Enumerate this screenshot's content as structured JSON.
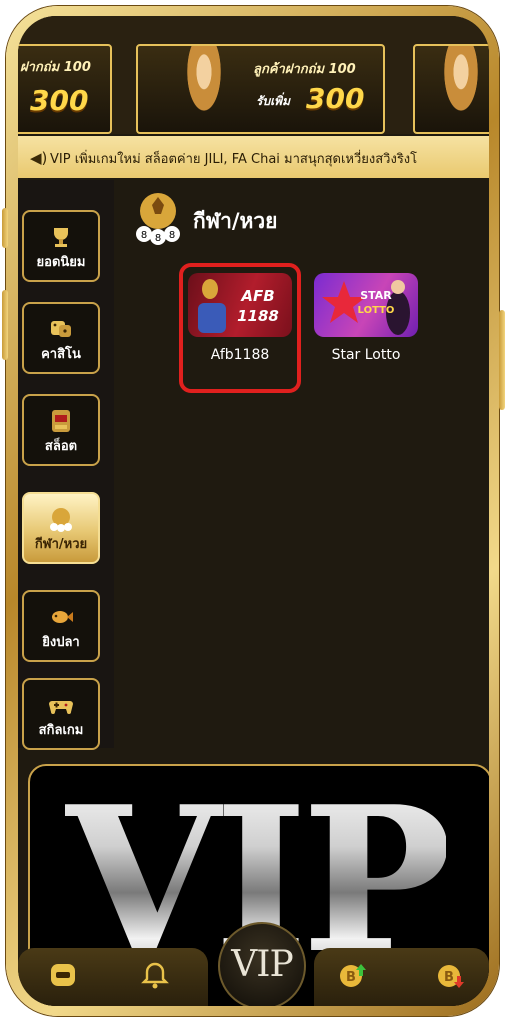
{
  "banners": [
    {
      "headline": "ฝากถ่ม 100",
      "amount": "300"
    },
    {
      "headline": "ลูกค้าฝากถ่ม 100",
      "small": "รับเพิ่ม",
      "amount": "300"
    },
    {
      "headline": "",
      "amount": ""
    }
  ],
  "marquee": {
    "icon": "speaker-icon",
    "text": "VIP เพิ่มเกมใหม่ สล็อตค่าย JILI, FA Chai มาสนุกสุดเหวี่ยงสวิงริงโ"
  },
  "sidebar": {
    "items": [
      {
        "label": "ยอดนิยม",
        "icon": "trophy-icon"
      },
      {
        "label": "คาสิโน",
        "icon": "dice-icon"
      },
      {
        "label": "สล็อต",
        "icon": "slot-machine-icon"
      },
      {
        "label": "กีฬา/หวย",
        "icon": "ball-lottery-icon",
        "active": true
      },
      {
        "label": "ยิงปลา",
        "icon": "fish-icon"
      },
      {
        "label": "สกิลเกม",
        "icon": "gamepad-icon"
      }
    ]
  },
  "section": {
    "title": "กีฬา/หวย",
    "icon": "ball-lottery-icon"
  },
  "games": [
    {
      "label": "Afb1188",
      "logo": "AFB 1188",
      "highlighted": true
    },
    {
      "label": "Star Lotto",
      "logo": "STAR LOTTO",
      "highlighted": false
    }
  ],
  "vip_banner": {
    "text": "VIP"
  },
  "bottom_nav": {
    "center_label": "VIP",
    "items": [
      {
        "icon": "line-icon"
      },
      {
        "icon": "bell-icon"
      },
      {
        "icon": "coin-deposit-icon"
      },
      {
        "icon": "coin-withdraw-icon"
      }
    ]
  },
  "colors": {
    "gold": "#c9a24a",
    "highlight": "#e0201e",
    "background": "#1f1a10"
  }
}
